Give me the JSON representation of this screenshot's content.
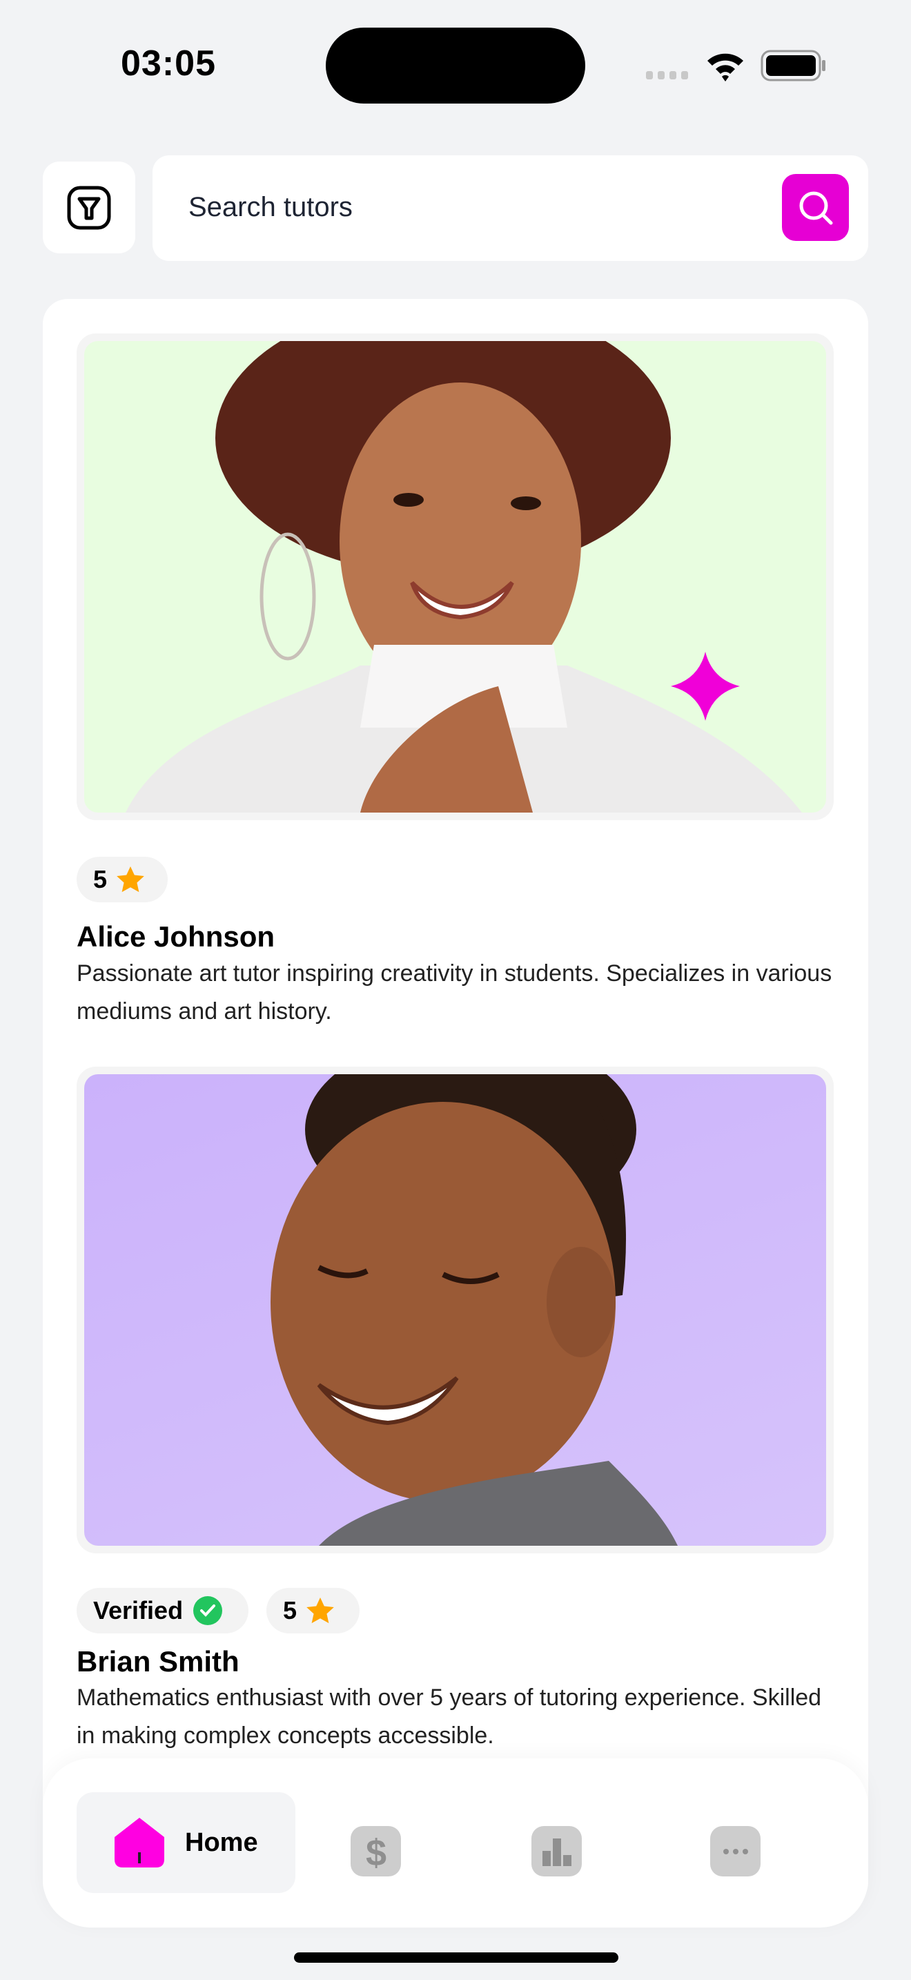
{
  "status_bar": {
    "time": "03:05"
  },
  "search": {
    "placeholder": "Search tutors",
    "filter_icon": "filter-icon",
    "search_icon": "search-icon"
  },
  "colors": {
    "accent": "#e600d4",
    "star": "#ffa500",
    "verified": "#22c55e",
    "alice_bg": "#e8fde0",
    "brian_bg": "#cfb6fb"
  },
  "tutors": [
    {
      "name": "Alice Johnson",
      "rating": "5",
      "verified": false,
      "description": "Passionate art tutor inspiring creativity in students. Specializes in various mediums and art history."
    },
    {
      "name": "Brian Smith",
      "rating": "5",
      "verified": true,
      "verified_label": "Verified",
      "description": "Mathematics enthusiast with over 5 years of tutoring experience. Skilled in making complex concepts accessible."
    }
  ],
  "nav": {
    "items": [
      {
        "label": "Home",
        "icon": "home-icon",
        "active": true
      },
      {
        "icon": "dollar-icon"
      },
      {
        "icon": "chart-icon"
      },
      {
        "icon": "more-icon"
      }
    ]
  }
}
